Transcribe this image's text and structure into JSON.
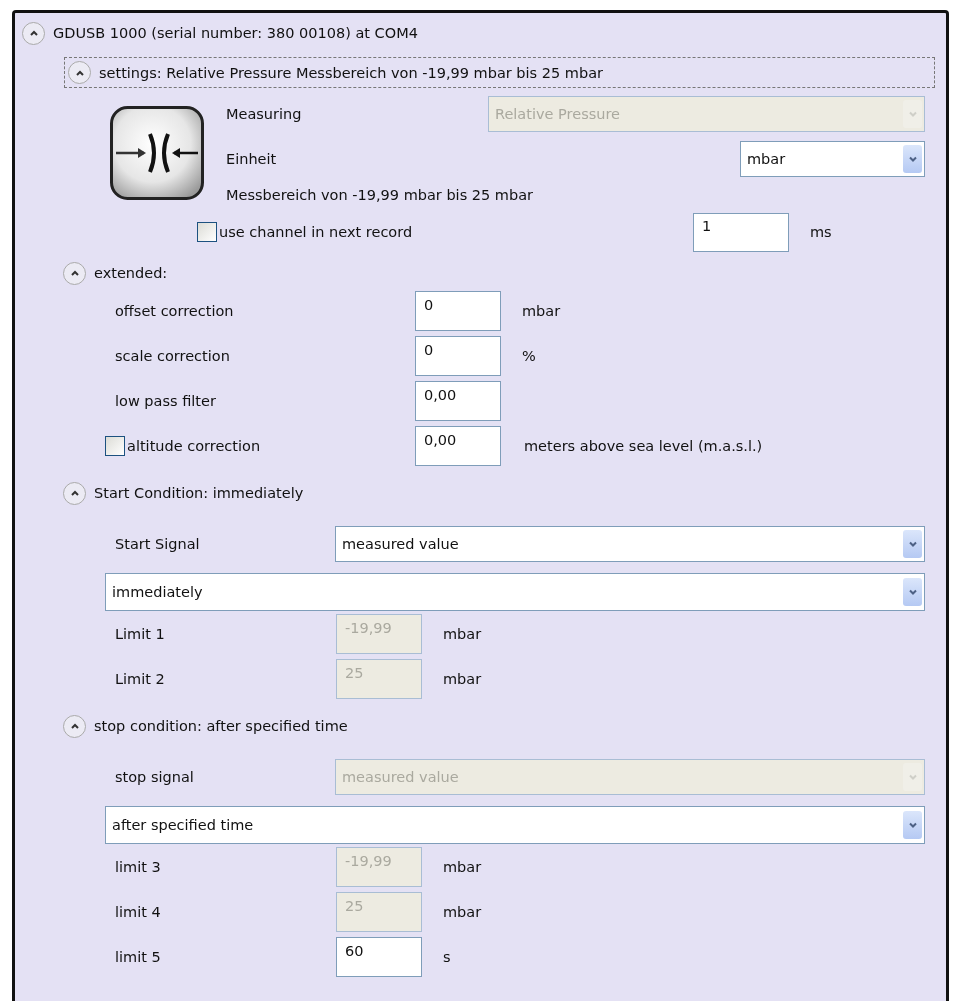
{
  "device": {
    "title": "GDUSB 1000 (serial number: 380 00108) at COM4",
    "expanded": true
  },
  "settings": {
    "title": "settings: Relative Pressure Messbereich von -19,99 mbar bis 25 mbar",
    "expanded": true,
    "measuring_label": "Measuring",
    "measuring": {
      "value": "Relative Pressure",
      "disabled": true
    },
    "unit_label": "Einheit",
    "unit": {
      "value": "mbar",
      "disabled": false
    },
    "range_text": "Messbereich von -19,99 mbar bis 25 mbar",
    "use_channel": {
      "label": "use channel in next record",
      "checked": false
    },
    "interval": {
      "value": "1",
      "unit": "ms"
    }
  },
  "extended": {
    "title": "extended:",
    "expanded": true,
    "rows": [
      {
        "kind": "plain",
        "label": "offset correction",
        "value": "0",
        "unit": "mbar"
      },
      {
        "kind": "plain",
        "label": "scale correction",
        "value": "0",
        "unit": "%"
      },
      {
        "kind": "plain",
        "label": "low pass filter",
        "value": "0,00"
      },
      {
        "kind": "checkbox",
        "label": "altitude correction",
        "checked": false,
        "value": "0,00",
        "unit": "meters above sea level (m.a.s.l.)"
      }
    ]
  },
  "start": {
    "title": "Start Condition: immediately",
    "expanded": true,
    "signal_label": "Start Signal",
    "signal": {
      "value": "measured value",
      "disabled": false
    },
    "mode": {
      "value": "immediately",
      "disabled": false
    },
    "limits": [
      {
        "label": "Limit 1",
        "value": "-19,99",
        "unit": "mbar",
        "disabled": true
      },
      {
        "label": "Limit 2",
        "value": "25",
        "unit": "mbar",
        "disabled": true
      }
    ]
  },
  "stop": {
    "title": "stop condition: after specified time",
    "expanded": true,
    "signal_label": "stop signal",
    "signal": {
      "value": "measured value",
      "disabled": true
    },
    "mode": {
      "value": "after specified time",
      "disabled": false
    },
    "limits": [
      {
        "label": "limit 3",
        "value": "-19,99",
        "unit": "mbar",
        "disabled": true
      },
      {
        "label": "limit 4",
        "value": "25",
        "unit": "mbar",
        "disabled": true
      },
      {
        "label": "limit 5",
        "value": "60",
        "unit": "s",
        "disabled": false
      }
    ]
  }
}
